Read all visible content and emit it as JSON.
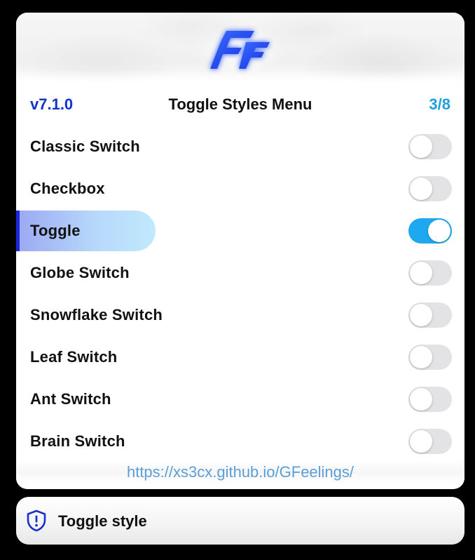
{
  "menu": {
    "version": "v7.1.0",
    "title": "Toggle Styles Menu",
    "page": "3/8",
    "logo_icon": "gf-logo-icon",
    "items": [
      {
        "label": "Classic Switch",
        "on": false,
        "selected": false
      },
      {
        "label": "Checkbox",
        "on": false,
        "selected": false
      },
      {
        "label": "Toggle",
        "on": true,
        "selected": true
      },
      {
        "label": "Globe Switch",
        "on": false,
        "selected": false
      },
      {
        "label": "Snowflake Switch",
        "on": false,
        "selected": false
      },
      {
        "label": "Leaf Switch",
        "on": false,
        "selected": false
      },
      {
        "label": "Ant Switch",
        "on": false,
        "selected": false
      },
      {
        "label": "Brain Switch",
        "on": false,
        "selected": false
      }
    ],
    "footer_link": "https://xs3cx.github.io/GFeelings/"
  },
  "toast": {
    "icon": "shield-alert-icon",
    "text": "Toggle style"
  },
  "colors": {
    "version": "#1133cc",
    "page_counter": "#1e9fe0",
    "switch_on": "#1ea8f0",
    "switch_off": "#e3e3e6",
    "selected_accent": "#1a28d8",
    "link": "#5b9fd6"
  }
}
